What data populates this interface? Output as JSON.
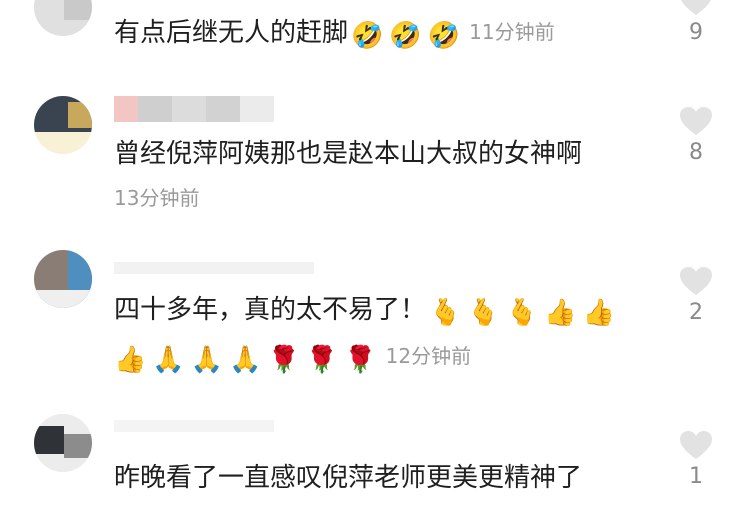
{
  "comments": [
    {
      "text": "有点后继无人的赶脚",
      "emojis": [
        "🤣",
        "🤣",
        "🤣"
      ],
      "time": "11分钟前",
      "likes": "9"
    },
    {
      "text": "曾经倪萍阿姨那也是赵本山大叔的女神啊",
      "time": "13分钟前",
      "likes": "8"
    },
    {
      "text": "四十多年，真的太不易了！",
      "emojis_line1": [
        "🫰",
        "🫰",
        "🫰",
        "👍",
        "👍"
      ],
      "emojis_line2": [
        "👍",
        "🙏",
        "🙏",
        "🙏",
        "🌹",
        "🌹",
        "🌹"
      ],
      "time": "12分钟前",
      "likes": "2"
    },
    {
      "text": "昨晚看了一直感叹倪萍老师更美更精神了",
      "likes": "1"
    }
  ],
  "icons": {
    "like": "heart-icon"
  },
  "colors": {
    "heart": "#e2e2e2",
    "time": "#9a9a9a",
    "like_count": "#8a8a8a"
  }
}
